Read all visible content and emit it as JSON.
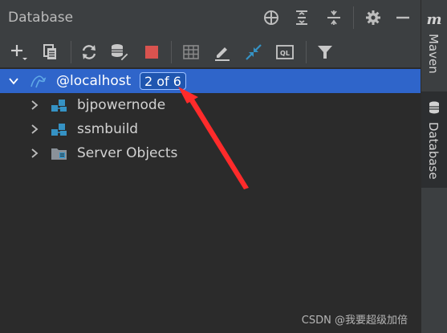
{
  "panel": {
    "title": "Database"
  },
  "header_icons": [
    "crosshair-icon",
    "expand-all-icon",
    "collapse-all-icon",
    "gear-icon",
    "minimize-icon"
  ],
  "toolbar_icons": [
    "add-icon",
    "copy-icon",
    "refresh-icon",
    "properties-icon",
    "stop-icon",
    "table-icon",
    "edit-icon",
    "jump-icon",
    "query-console-icon",
    "filter-icon"
  ],
  "tree": {
    "root": {
      "label": "@localhost",
      "badge": "2 of 6",
      "expanded": true,
      "selected": true
    },
    "children": [
      {
        "label": "bjpowernode",
        "icon": "schema-icon"
      },
      {
        "label": "ssmbuild",
        "icon": "schema-icon"
      },
      {
        "label": "Server Objects",
        "icon": "server-objects-icon"
      }
    ]
  },
  "right_stripe": {
    "maven_glyph": "m",
    "maven_label": "Maven",
    "database_label": "Database"
  },
  "annotation": {
    "color": "#ff2b2b"
  },
  "watermark": "CSDN @我要超级加倍",
  "colors": {
    "selection": "#2f65ca",
    "panel_bg": "#3c3f41",
    "tree_bg": "#2b2b2b",
    "stop_red": "#d9534f",
    "accent_blue": "#3592c4"
  }
}
